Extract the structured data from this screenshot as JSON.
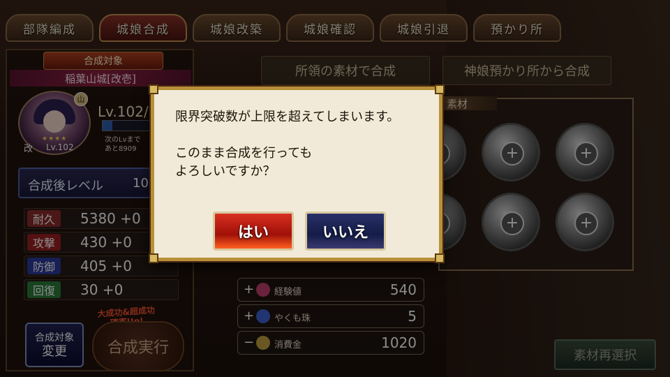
{
  "tabs": [
    {
      "label": "部隊編成"
    },
    {
      "label": "城娘合成"
    },
    {
      "label": "城娘改築"
    },
    {
      "label": "城娘確認"
    },
    {
      "label": "城娘引退"
    },
    {
      "label": "預かり所"
    }
  ],
  "left": {
    "target_label": "合成対象",
    "castle_name": "稲葉山城[改壱]",
    "kai": "改",
    "char_level": "Lv.102",
    "stars": "★★★★",
    "badge": "山",
    "level_display": "Lv.102/",
    "level_progress": 0.2,
    "next_lv_line1": "次のLvまで",
    "next_lv_line2": "あと8909",
    "after_level_label": "合成後レベル",
    "after_level_value": "10",
    "stats": [
      {
        "name": "耐久",
        "value": "5380 +0",
        "color": "#8a2a2a"
      },
      {
        "name": "攻撃",
        "value": "430 +0",
        "color": "#9a2020"
      },
      {
        "name": "防御",
        "value": "405 +0",
        "color": "#2a3a9a"
      },
      {
        "name": "回復",
        "value": "30 +0",
        "color": "#2a7a3a"
      }
    ],
    "bonus_note_line1": "大成功&超成功",
    "bonus_note_line2": "確率Up!",
    "change_btn_line1": "合成対象",
    "change_btn_line2": "変更",
    "exec_btn": "合成実行"
  },
  "right": {
    "source_tab1": "所領の素材で合成",
    "source_tab2": "神娘預かり所から合成",
    "material_label": "素材",
    "costs": [
      {
        "sign": "+",
        "name": "経験値",
        "value": "540",
        "icon": "exp-icon",
        "color": "#c04070"
      },
      {
        "sign": "+",
        "name": "やくも珠",
        "value": "5",
        "icon": "orb-icon",
        "color": "#4060d0"
      },
      {
        "sign": "−",
        "name": "消費金",
        "value": "1020",
        "icon": "coin-icon",
        "color": "#c0a040"
      }
    ],
    "reselect_btn": "素材再選択"
  },
  "dialog": {
    "line1": "限界突破数が上限を超えてしまいます。",
    "line2": "このまま合成を行っても",
    "line3": "よろしいですか？",
    "yes": "はい",
    "no": "いいえ"
  }
}
